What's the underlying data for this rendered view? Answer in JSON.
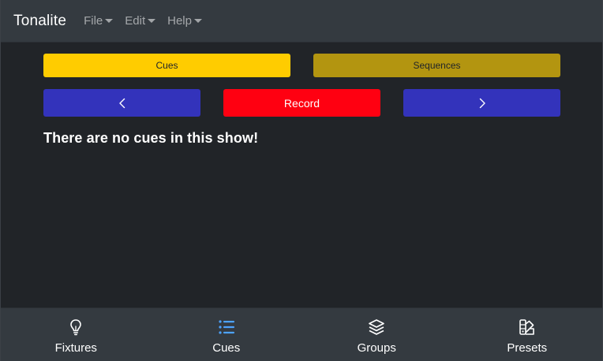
{
  "navbar": {
    "brand": "Tonalite",
    "menu": [
      {
        "label": "File"
      },
      {
        "label": "Edit"
      },
      {
        "label": "Help"
      }
    ]
  },
  "tabs": {
    "cues": "Cues",
    "sequences": "Sequences"
  },
  "controls": {
    "prev_icon": "chevron-left-icon",
    "record_label": "Record",
    "next_icon": "chevron-right-icon"
  },
  "main": {
    "empty_message": "There are no cues in this show!"
  },
  "bottom_nav": {
    "items": [
      {
        "label": "Fixtures",
        "icon": "lightbulb-icon",
        "active": false
      },
      {
        "label": "Cues",
        "icon": "list-icon",
        "active": true
      },
      {
        "label": "Groups",
        "icon": "layers-icon",
        "active": false
      },
      {
        "label": "Presets",
        "icon": "swatches-icon",
        "active": false
      }
    ]
  },
  "colors": {
    "background": "#212428",
    "bar": "#343a40",
    "tab_active": "#ffcc00",
    "tab_inactive": "#b39510",
    "nav_button": "#3333bb",
    "record_button": "#ff0011",
    "active_icon": "#4da3ff"
  }
}
